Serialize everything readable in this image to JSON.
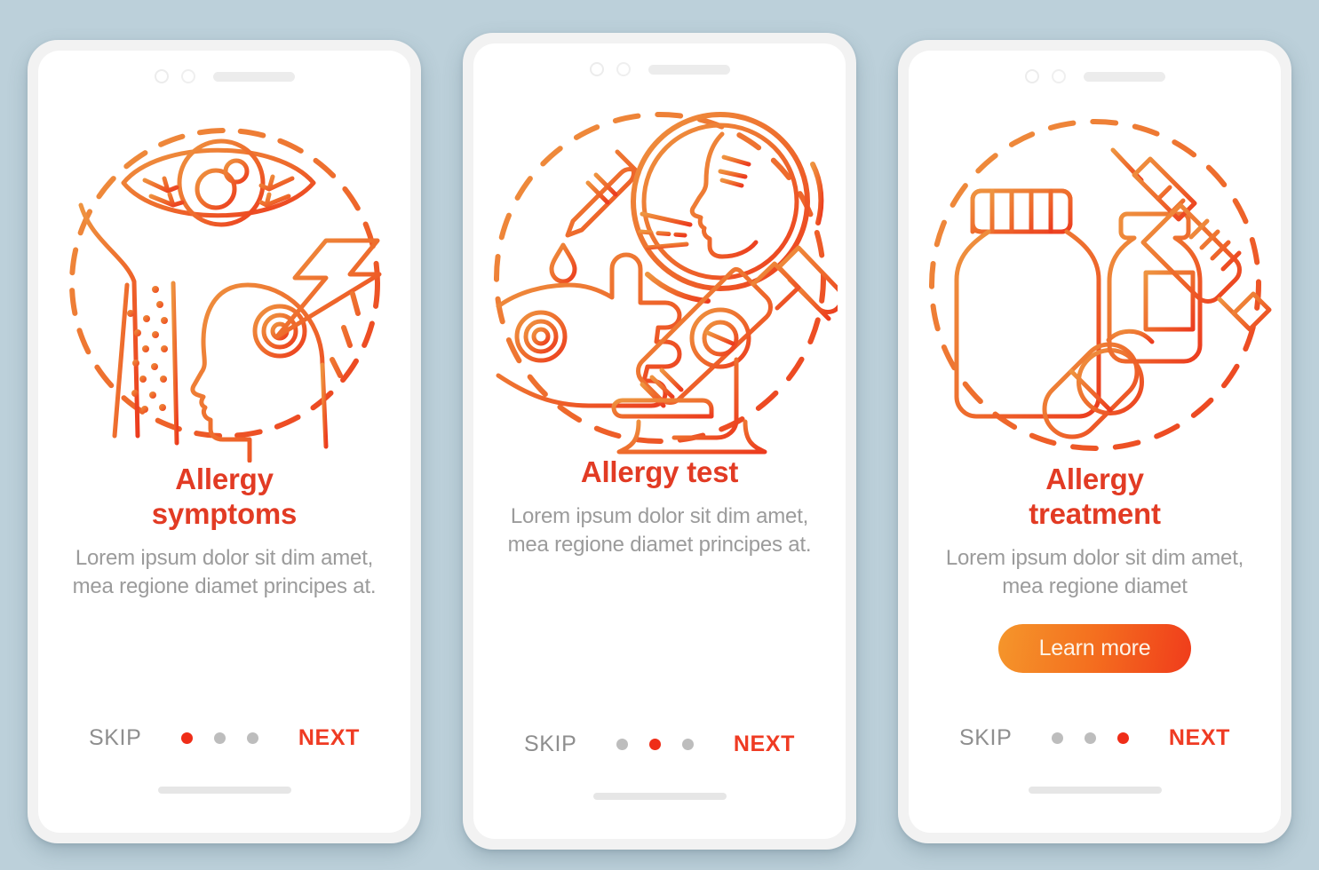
{
  "theme": {
    "page_background": "#bcd0da",
    "screen_background": "#ffffff",
    "frame_color": "#f2f2f2",
    "title_color": "#e23b24",
    "description_color": "#9b9b9b",
    "skip_color": "#8e8e8e",
    "next_color": "#ef3b23",
    "dot_active_color": "#ef2d18",
    "dot_inactive_color": "#bdbdbd",
    "cta_gradient_start": "#f5962b",
    "cta_gradient_end": "#f03c1b",
    "illustration_gradient_start": "#ee9440",
    "illustration_gradient_end": "#ec3b1e"
  },
  "screens": [
    {
      "title": "Allergy\nsymptoms",
      "title_line1": "Allergy",
      "title_line2": "symptoms",
      "description": "Lorem ipsum dolor sit dim amet, mea regione diamet principes at.",
      "illustration": "allergy-symptoms-illustration",
      "illustration_parts": [
        "irritated-eye-icon",
        "rash-arm-icon",
        "headache-head-icon",
        "lightning-bolt-icon",
        "dashed-circle"
      ],
      "cta": null,
      "skip_label": "SKIP",
      "next_label": "NEXT",
      "dots": {
        "count": 3,
        "active_index": 0
      }
    },
    {
      "title": "Allergy test",
      "title_line1": "Allergy test",
      "title_line2": "",
      "description": "Lorem ipsum dolor sit dim amet, mea regione diamet principes at.",
      "illustration": "allergy-test-illustration",
      "illustration_parts": [
        "dropper-pipette-icon",
        "hand-skin-prick-icon",
        "magnifier-sneezing-face-icon",
        "microscope-icon",
        "dashed-circle"
      ],
      "cta": null,
      "skip_label": "SKIP",
      "next_label": "NEXT",
      "dots": {
        "count": 3,
        "active_index": 1
      }
    },
    {
      "title": "Allergy\ntreatment",
      "title_line1": "Allergy",
      "title_line2": "treatment",
      "description": "Lorem ipsum dolor sit dim amet, mea regione diamet",
      "illustration": "allergy-treatment-illustration",
      "illustration_parts": [
        "pill-bottle-icon",
        "capsule-pills-icon",
        "medicine-vial-icon",
        "syringe-icon",
        "dashed-circle"
      ],
      "cta": "Learn more",
      "skip_label": "SKIP",
      "next_label": "NEXT",
      "dots": {
        "count": 3,
        "active_index": 2
      }
    }
  ]
}
